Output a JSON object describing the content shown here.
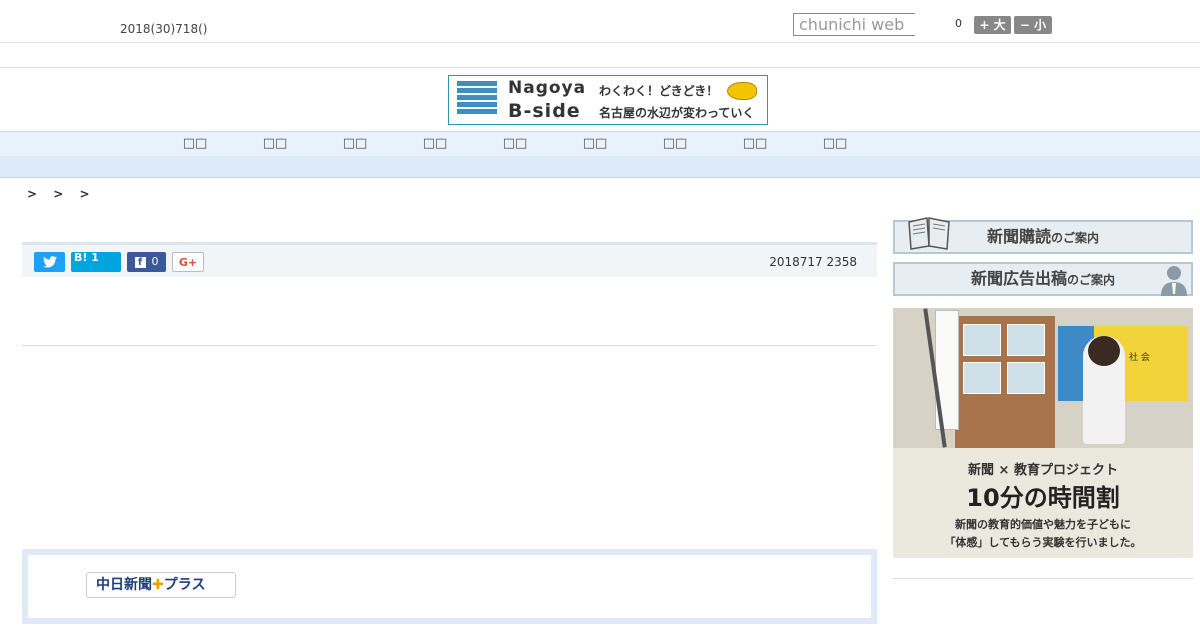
{
  "header": {
    "date": "2018(30)718()",
    "search_placeholder": "chunichi web",
    "count": "0",
    "font_big": "+ 大",
    "font_small": "− 小"
  },
  "banner": {
    "title_line1": "Nagoya",
    "title_line2": "B-side",
    "catch1": "わくわく！どきどき！",
    "catch2": "名古屋の水辺が変わっていく"
  },
  "nav": {
    "items": [
      "",
      "",
      "",
      "",
      "",
      "",
      "",
      "",
      ""
    ]
  },
  "breadcrumb": "> > >",
  "article": {
    "share_hatena": "B! 1",
    "share_facebook_count": "0",
    "share_gplus": "G+",
    "timestamp": "2018717 2358"
  },
  "plus": {
    "logo_text_left": "中日新聞",
    "logo_cross": "✚",
    "logo_text_right": "プラス"
  },
  "sidebar": {
    "subscribe_main": "新聞購読",
    "subscribe_small": "のご案内",
    "ad_main": "新聞広告出稿",
    "ad_small": "のご案内",
    "promo_label": "社 会",
    "promo_line1": "新聞 × 教育プロジェクト",
    "promo_line2": "10分の時間割",
    "promo_line3": "新聞の教育的価値や魅力を子どもに",
    "promo_line4": "「体感」してもらう実験を行いました。"
  },
  "colors": {
    "nav_bg": "#e9f1fa",
    "subnav_bg": "#dce9f6",
    "twitter": "#1da1f2",
    "hatena": "#00a4de",
    "facebook": "#3b5998"
  }
}
